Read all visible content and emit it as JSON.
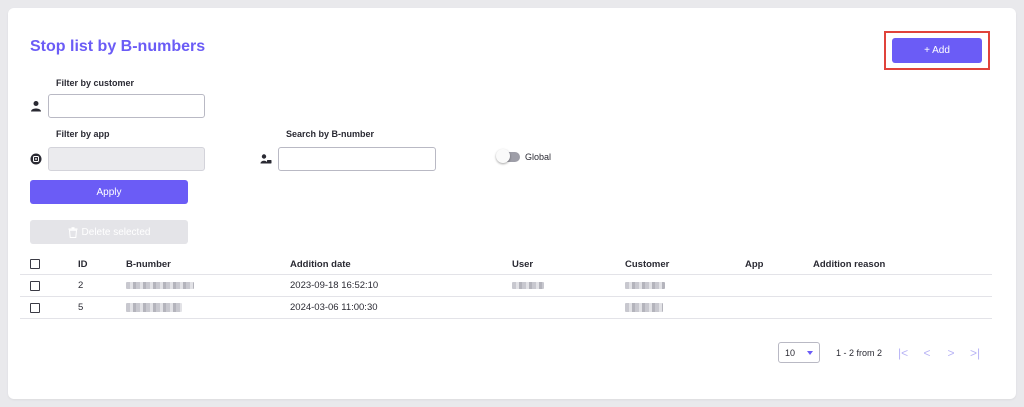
{
  "page": {
    "title": "Stop list by B-numbers"
  },
  "toolbar": {
    "add_label": "+ Add"
  },
  "filters": {
    "customer_label": "Filter by customer",
    "customer_value": "",
    "app_label": "Filter by app",
    "app_value": "",
    "bnumber_label": "Search by B-number",
    "bnumber_value": "",
    "global_label": "Global",
    "global_on": false,
    "apply_label": "Apply",
    "delete_label": "Delete selected"
  },
  "table": {
    "columns": [
      "ID",
      "B-number",
      "Addition date",
      "User",
      "Customer",
      "App",
      "Addition reason"
    ],
    "rows": [
      {
        "id": "2",
        "date": "2023-09-18 16:52:10"
      },
      {
        "id": "5",
        "date": "2024-03-06 11:00:30"
      }
    ]
  },
  "pagination": {
    "page_size": "10",
    "range": "1 - 2 from 2"
  },
  "colors": {
    "accent": "#6b5cf6",
    "highlight": "#e0433b"
  },
  "icons": [
    "user-icon",
    "app-icon",
    "user-search-icon",
    "trash-icon",
    "first-page-icon",
    "prev-page-icon",
    "next-page-icon",
    "last-page-icon",
    "caret-down-icon"
  ]
}
